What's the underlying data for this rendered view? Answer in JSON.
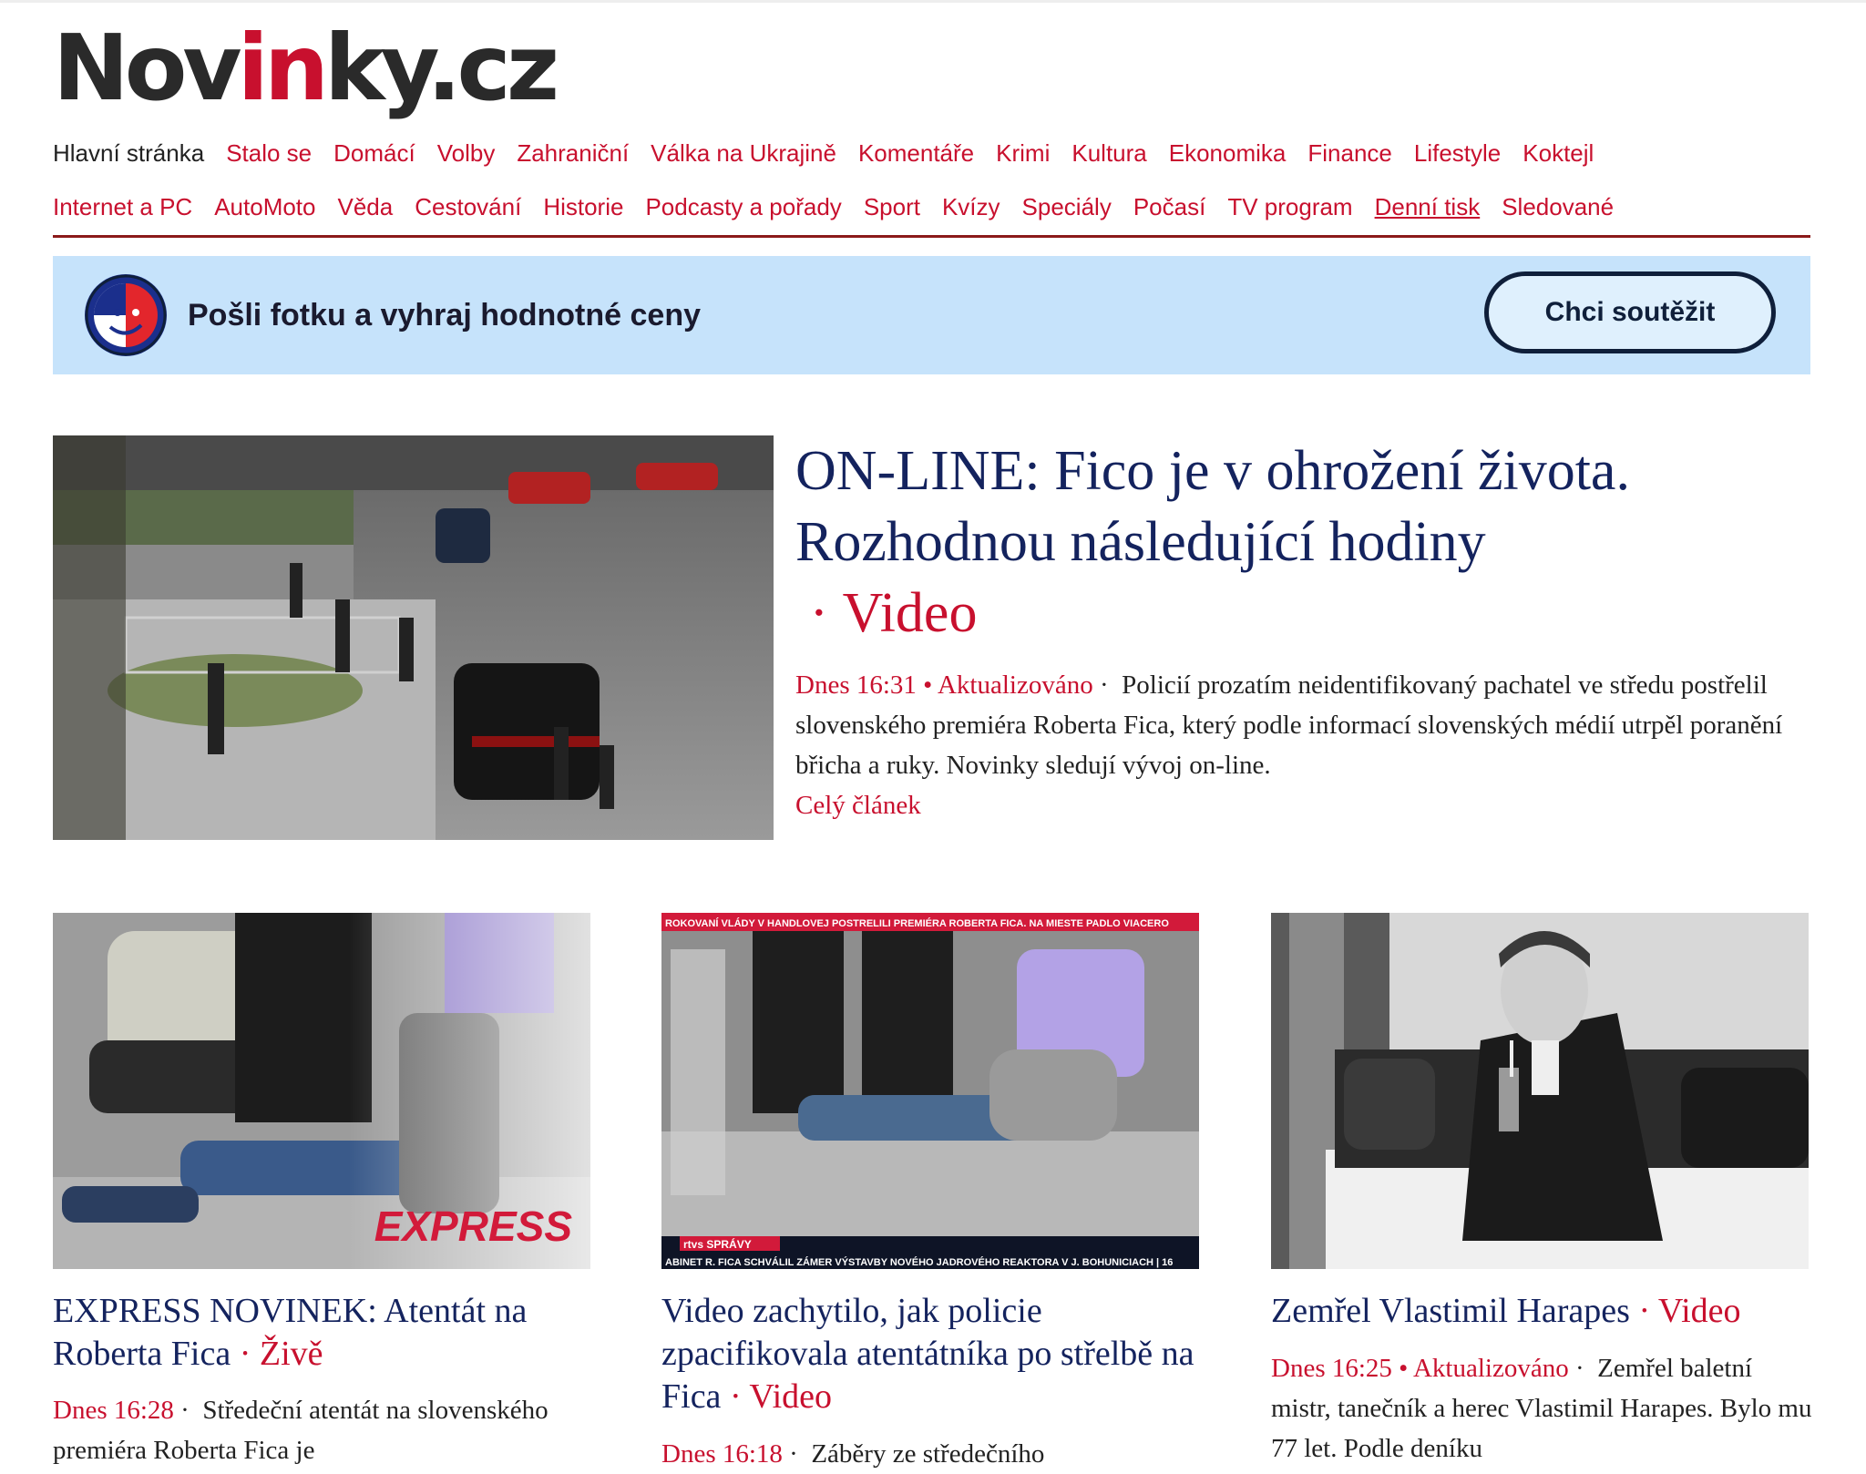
{
  "logo": {
    "prefix": "Nov",
    "accent": "in",
    "suffix": "ky.cz"
  },
  "nav": {
    "row1": [
      "Hlavní stránka",
      "Stalo se",
      "Domácí",
      "Volby",
      "Zahraniční",
      "Válka na Ukrajině",
      "Komentáře",
      "Krimi",
      "Kultura",
      "Ekonomika",
      "Finance",
      "Lifestyle",
      "Koktejl"
    ],
    "row2": [
      "Internet a PC",
      "AutoMoto",
      "Věda",
      "Cestování",
      "Historie",
      "Podcasty a pořady",
      "Sport",
      "Kvízy",
      "Speciály",
      "Počasí",
      "TV program",
      "Denní tisk",
      "Sledované"
    ]
  },
  "promo": {
    "text": "Pošli fotku a vyhraj hodnotné ceny",
    "button": "Chci soutěžit"
  },
  "lead": {
    "title": "ON-LINE: Fico je v ohrožení života. Rozhodnou následující hodiny",
    "tag": "Video",
    "time": "Dnes 16:31",
    "updated": "Aktualizováno",
    "perex": "Policií prozatím neidentifikovaný pachatel ve středu postřelil slovenského premiéra Roberta Fica, který podle informací slovenských médií utrpěl poranění břicha a ruky. Novinky sledují vývoj on-line.",
    "more": "Celý článek"
  },
  "cards": [
    {
      "title": "EXPRESS NOVINEK: Atentát na Roberta Fica",
      "tag": "Živě",
      "time": "Dnes 16:28",
      "updated": "",
      "perex": "Středeční atentát na slovenského premiéra Roberta Fica je",
      "image_label": "EXPRESS"
    },
    {
      "title": "Video zachytilo, jak policie zpacifikovala atentátníka po střelbě na Fica",
      "tag": "Video",
      "time": "Dnes 16:18",
      "updated": "",
      "perex": "Záběry ze středečního",
      "ticker_top": "ROKOVANÍ VLÁDY V HANDLOVEJ POSTRELILI PREMIÉRA ROBERTA FICA. NA MIESTE PADLO VIACERO",
      "ticker_bottom": "ABINET R. FICA SCHVÁLIL ZÁMER VÝSTAVBY NOVÉHO JADROVÉHO REAKTORA V J. BOHUNICIACH | 16",
      "logo_label": "rtvs SPRÁVY"
    },
    {
      "title": "Zemřel Vlastimil Harapes",
      "tag": "Video",
      "time": "Dnes 16:25",
      "updated": "Aktualizováno",
      "perex": "Zemřel baletní mistr, tanečník a herec Vlastimil Harapes. Bylo mu 77 let. Podle deníku"
    }
  ],
  "colors": {
    "accent": "#c8102e",
    "headline": "#14235e",
    "promo_bg": "#c6e3fb",
    "nav_rule": "#8b1a1a"
  },
  "icons": [
    "promo-badge-icon"
  ]
}
